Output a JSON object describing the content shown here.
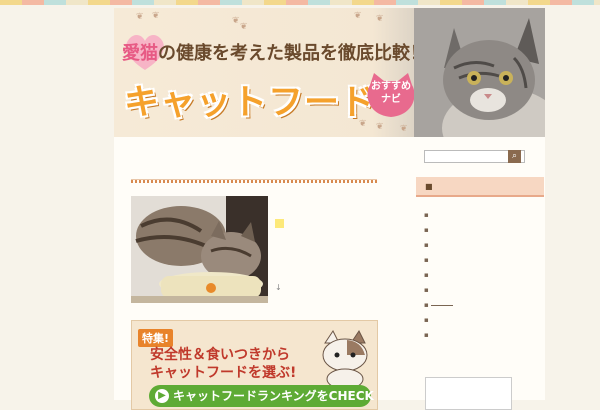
{
  "banner": {
    "tagline_pre": "愛猫",
    "tagline_rest": "の健康を考えた製品を徹底比較！",
    "title": "キャットフード",
    "badge_line1": "おすすめ",
    "badge_line2": "ナビ"
  },
  "promo": {
    "tag": "特集!",
    "line1": "安全性＆食いつきから",
    "line2": "キャットフードを選ぶ!",
    "button": "キャットフードランキングをCHECK"
  },
  "sidebar": {
    "search_placeholder": "",
    "category_icon": "folder-icon",
    "items": [
      "▪",
      "▪",
      "▪",
      "▪",
      "▪",
      "▪",
      "▪",
      "▪",
      "▪"
    ]
  },
  "colors": {
    "accent_orange": "#f5a12c",
    "pink": "#e75a84",
    "button_green": "#5eab35",
    "brown": "#6a4a2d"
  }
}
